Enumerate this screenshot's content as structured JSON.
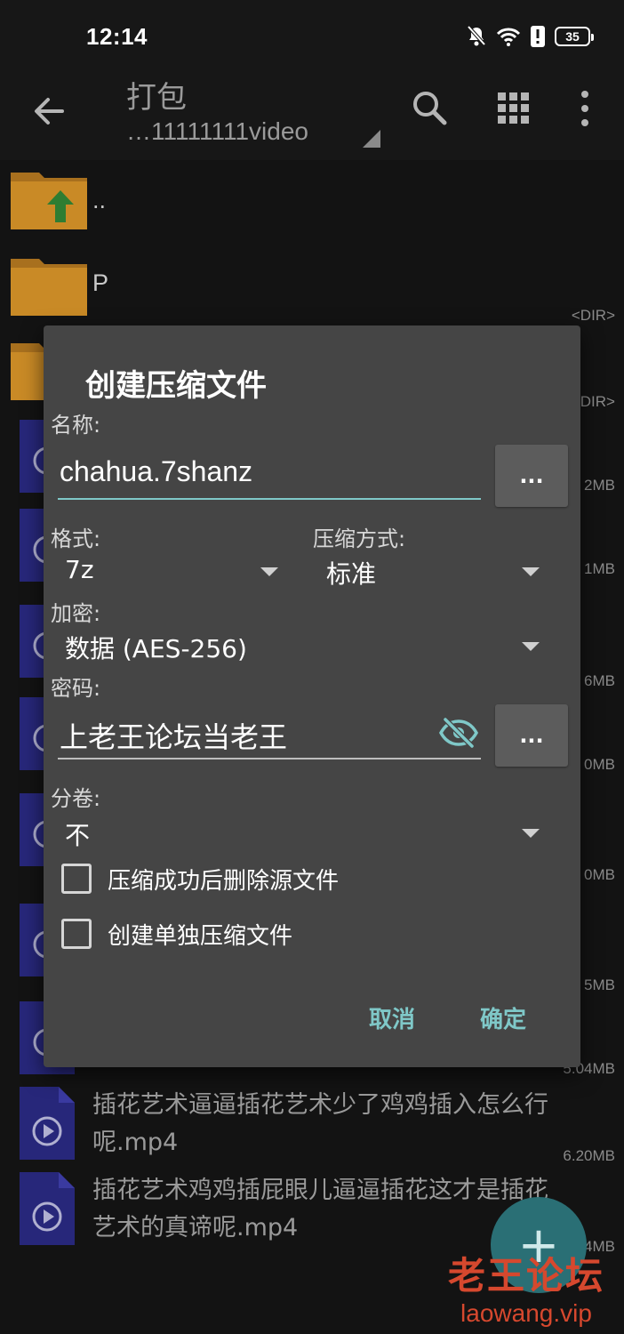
{
  "status_bar": {
    "time": "12:14",
    "battery": "35",
    "icons": [
      "mute-bell-icon",
      "wifi-icon",
      "alert-icon",
      "battery-icon"
    ]
  },
  "toolbar": {
    "title": "打包",
    "subtitle": "…11111111video",
    "icons": [
      "back-arrow-icon",
      "search-icon",
      "grid-view-icon",
      "more-vert-icon"
    ]
  },
  "file_list": {
    "rows": [
      {
        "name": "..",
        "meta": "",
        "icon": "folder-up-icon"
      },
      {
        "name": "P",
        "meta": "<DIR>",
        "icon": "folder-icon"
      }
    ],
    "partial_meta": [
      "DIR>",
      "2MB",
      "1MB",
      "6MB",
      "0MB",
      "0MB",
      "5MB"
    ],
    "files": [
      {
        "name": "插花艺术逼逼插花艺术少了鸡鸡插入怎么行呢.mp4",
        "size": "5.04MB"
      },
      {
        "name": "插花艺术鸡鸡插屁眼儿逼逼插花这才是插花艺术的真谛呢.mp4",
        "size": "6.20MB"
      }
    ],
    "last_partial_meta": "4MB"
  },
  "dialog": {
    "title": "创建压缩文件",
    "name_label": "名称:",
    "name_value": "chahua.7shanz",
    "browse_label": "...",
    "format_label": "格式:",
    "format_value": "7z",
    "method_label": "压缩方式:",
    "method_value": "标准",
    "encryption_label": "加密:",
    "encryption_value": "数据 (AES-256)",
    "password_label": "密码:",
    "password_value": "上老王论坛当老王",
    "password_more_label": "...",
    "split_label": "分卷:",
    "split_value": "不",
    "delete_source_label": "压缩成功后删除源文件",
    "delete_source_checked": false,
    "separate_archives_label": "创建单独压缩文件",
    "separate_archives_checked": false,
    "cancel_label": "取消",
    "ok_label": "确定",
    "accent_color": "#7fc8c8"
  },
  "fab": {
    "label": "+"
  },
  "watermark": {
    "title": "老王论坛",
    "url": "laowang.vip"
  }
}
